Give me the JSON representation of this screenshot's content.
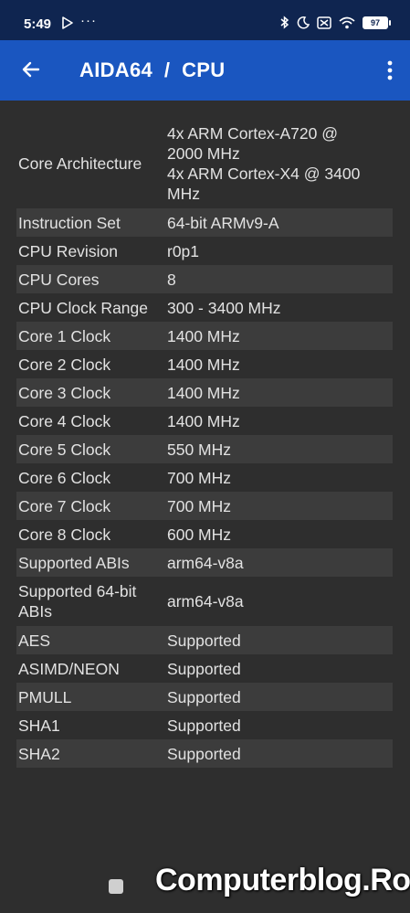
{
  "status_bar": {
    "time": "5:49",
    "overflow": "···",
    "battery": "97"
  },
  "app_bar": {
    "title": "AIDA64  /  CPU"
  },
  "rows": [
    {
      "label": "Core Architecture",
      "value_lines": [
        "4x ARM Cortex-A720 @",
        "2000 MHz",
        "4x ARM Cortex-X4 @ 3400",
        "MHz"
      ]
    },
    {
      "label": "Instruction Set",
      "value": "64-bit ARMv9-A"
    },
    {
      "label": "CPU Revision",
      "value": "r0p1"
    },
    {
      "label": "CPU Cores",
      "value": "8"
    },
    {
      "label": "CPU Clock Range",
      "value": "300 - 3400 MHz"
    },
    {
      "label": "Core 1 Clock",
      "value": "1400 MHz"
    },
    {
      "label": "Core 2 Clock",
      "value": "1400 MHz"
    },
    {
      "label": "Core 3 Clock",
      "value": "1400 MHz"
    },
    {
      "label": "Core 4 Clock",
      "value": "1400 MHz"
    },
    {
      "label": "Core 5 Clock",
      "value": "550 MHz"
    },
    {
      "label": "Core 6 Clock",
      "value": "700 MHz"
    },
    {
      "label": "Core 7 Clock",
      "value": "700 MHz"
    },
    {
      "label": "Core 8 Clock",
      "value": "600 MHz"
    },
    {
      "label": "Supported ABIs",
      "value": "arm64-v8a"
    },
    {
      "label_lines": [
        "Supported 64-bit",
        "ABIs"
      ],
      "value": "arm64-v8a"
    },
    {
      "label": "AES",
      "value": "Supported"
    },
    {
      "label": "ASIMD/NEON",
      "value": "Supported"
    },
    {
      "label": "PMULL",
      "value": "Supported"
    },
    {
      "label": "SHA1",
      "value": "Supported"
    },
    {
      "label": "SHA2",
      "value": "Supported"
    }
  ],
  "watermark": "Computerblog.Ro",
  "colors": {
    "status_bar": "#0f2550",
    "app_bar": "#1a56c0",
    "background": "#2e2e2e",
    "row_alt": "#3c3c3c"
  }
}
